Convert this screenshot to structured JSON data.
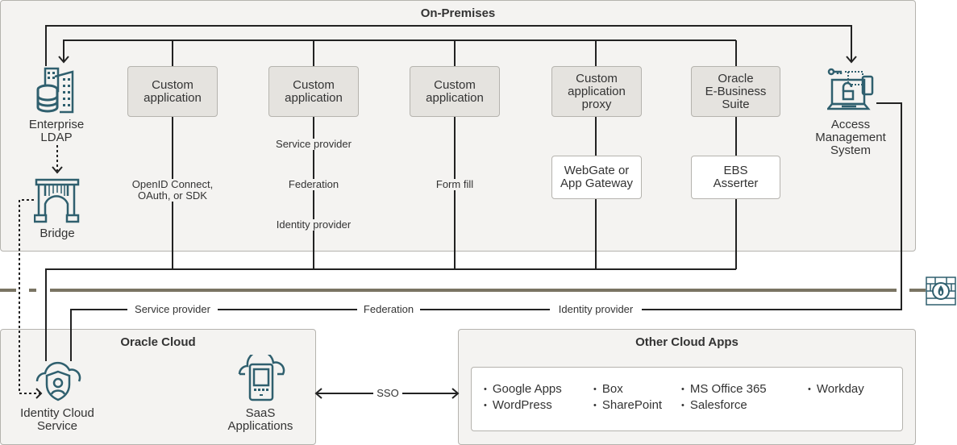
{
  "zones": {
    "on_premises": "On-Premises",
    "oracle_cloud": "Oracle Cloud",
    "other_cloud_apps": "Other Cloud Apps"
  },
  "apps": [
    {
      "label": "Custom\napplication",
      "connector": "OpenID Connect,\nOAuth, or SDK"
    },
    {
      "label": "Custom\napplication",
      "connector_top": "Service provider",
      "connector_mid": "Federation",
      "connector_bottom": "Identity provider"
    },
    {
      "label": "Custom\napplication",
      "connector": "Form fill"
    },
    {
      "label": "Custom\napplication\nproxy",
      "agent": "WebGate or\nApp Gateway"
    },
    {
      "label": "Oracle\nE-Business\nSuite",
      "agent": "EBS\nAsserter"
    }
  ],
  "nodes": {
    "ldap": "Enterprise\nLDAP",
    "bridge": "Bridge",
    "ams": "Access\nManagement\nSystem",
    "idcs": "Identity Cloud\nService",
    "saas": "SaaS\nApplications"
  },
  "federation_line": {
    "sp": "Service provider",
    "fed": "Federation",
    "idp": "Identity provider"
  },
  "sso_label": "SSO",
  "cloud_apps": [
    [
      "Google Apps",
      "WordPress"
    ],
    [
      "Box",
      "SharePoint"
    ],
    [
      "MS Office 365",
      "Salesforce"
    ],
    [
      "Workday"
    ]
  ],
  "colors": {
    "icon": "#2f5f6e",
    "line": "#222222",
    "firewall_line": "#7a7463"
  }
}
